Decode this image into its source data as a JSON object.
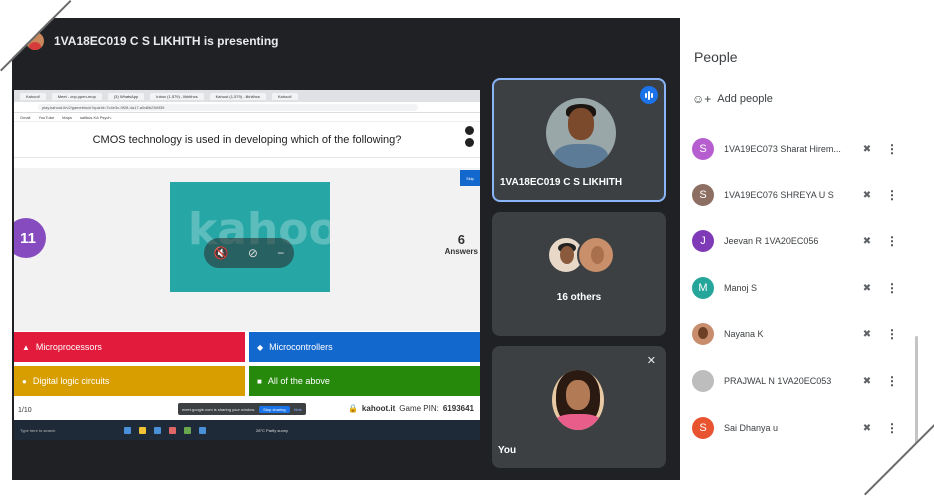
{
  "topbar": {
    "presenting_text": "1VA18EC019 C S LIKHITH is presenting"
  },
  "shared_screen": {
    "browser_tabs": [
      "Kahoot!",
      "Meet - cnp-ypen-mop",
      "(3) WhatsApp",
      "Inbox (1,579) - likhithcs",
      "Kahoot (1,579) - likhithcs",
      "Kahoot!"
    ],
    "url": "play.kahoot.it/v2/gameblock?quizId=7c4e3c-9f28-4a17-a0d8b23f4f39",
    "bookmarks": [
      "Gmail",
      "YouTube",
      "Maps",
      "sallbus KA Psych."
    ],
    "question": "CMOS technology is used in developing which of the following?",
    "timer": "11",
    "answers_count": "6",
    "answers_label": "Answers",
    "skip_label": "Skip",
    "options": [
      "Microprocessors",
      "Microcontrollers",
      "Digital logic circuits",
      "All of the above"
    ],
    "footer_left": "1/10",
    "share_notice": "meet.google.com is sharing your window.",
    "stop_sharing": "Stop sharing",
    "hide": "Hide",
    "site_name": "kahoot.it",
    "game_pin_label": "Game PIN:",
    "game_pin": "6193641",
    "taskbar_search": "Type here to search",
    "taskbar_weather": "28°C Partly sunny"
  },
  "tiles": {
    "presenter_name": "1VA18EC019 C S LIKHITH",
    "others_label": "16 others",
    "self_label": "You"
  },
  "people_panel": {
    "title": "People",
    "add_people": "Add people",
    "participants": [
      {
        "initial": "S",
        "name": "1VA19EC073 Sharat Hirem...",
        "color": "#b65ecf"
      },
      {
        "initial": "S",
        "name": "1VA19EC076 SHREYA U S",
        "color": "#8d6e63"
      },
      {
        "initial": "J",
        "name": "Jeevan R 1VA20EC056",
        "color": "#7e3ab7"
      },
      {
        "initial": "M",
        "name": "Manoj S",
        "color": "#26a69a"
      },
      {
        "initial": "",
        "name": "Nayana K",
        "color": "#c88d6d"
      },
      {
        "initial": "",
        "name": "PRAJWAL N 1VA20EC053",
        "color": "#9e9e9e"
      },
      {
        "initial": "S",
        "name": "Sai Dhanya u",
        "color": "#e8542f"
      }
    ]
  }
}
